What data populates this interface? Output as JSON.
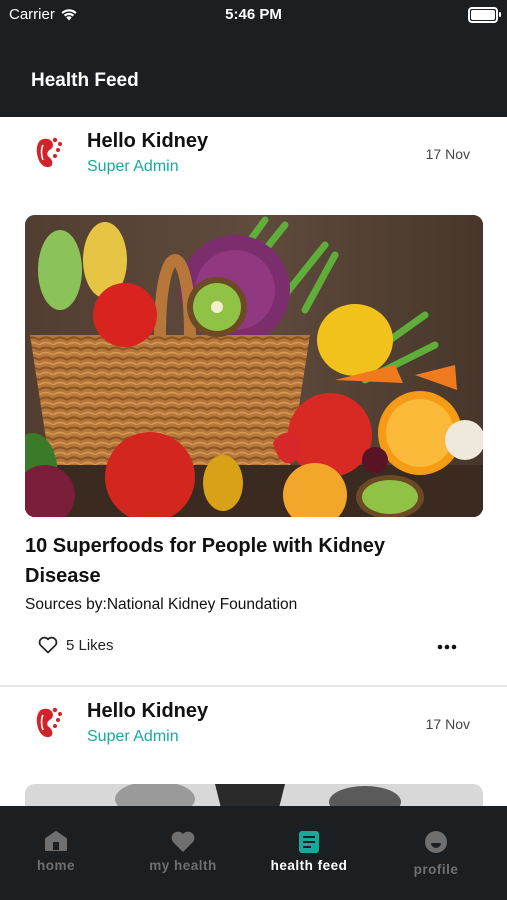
{
  "status_bar": {
    "carrier": "Carrier",
    "time": "5:46 PM"
  },
  "nav": {
    "title": "Health Feed"
  },
  "posts": [
    {
      "author": "Hello Kidney",
      "role": "Super Admin",
      "date": "17 Nov",
      "title": "10 Superfoods for People with Kidney Disease",
      "source": "Sources by:National Kidney Foundation",
      "likes": "5 Likes"
    },
    {
      "author": "Hello Kidney",
      "role": "Super Admin",
      "date": "17 Nov"
    }
  ],
  "tabs": [
    {
      "label": "home",
      "icon": "home-icon"
    },
    {
      "label": "my health",
      "icon": "heart-icon"
    },
    {
      "label": "health feed",
      "icon": "feed-icon",
      "active": true
    },
    {
      "label": "profile",
      "icon": "smiley-icon"
    }
  ],
  "colors": {
    "accent": "#19a99b",
    "bar_bg": "#1b1f22",
    "kidney": "#d2232a"
  }
}
